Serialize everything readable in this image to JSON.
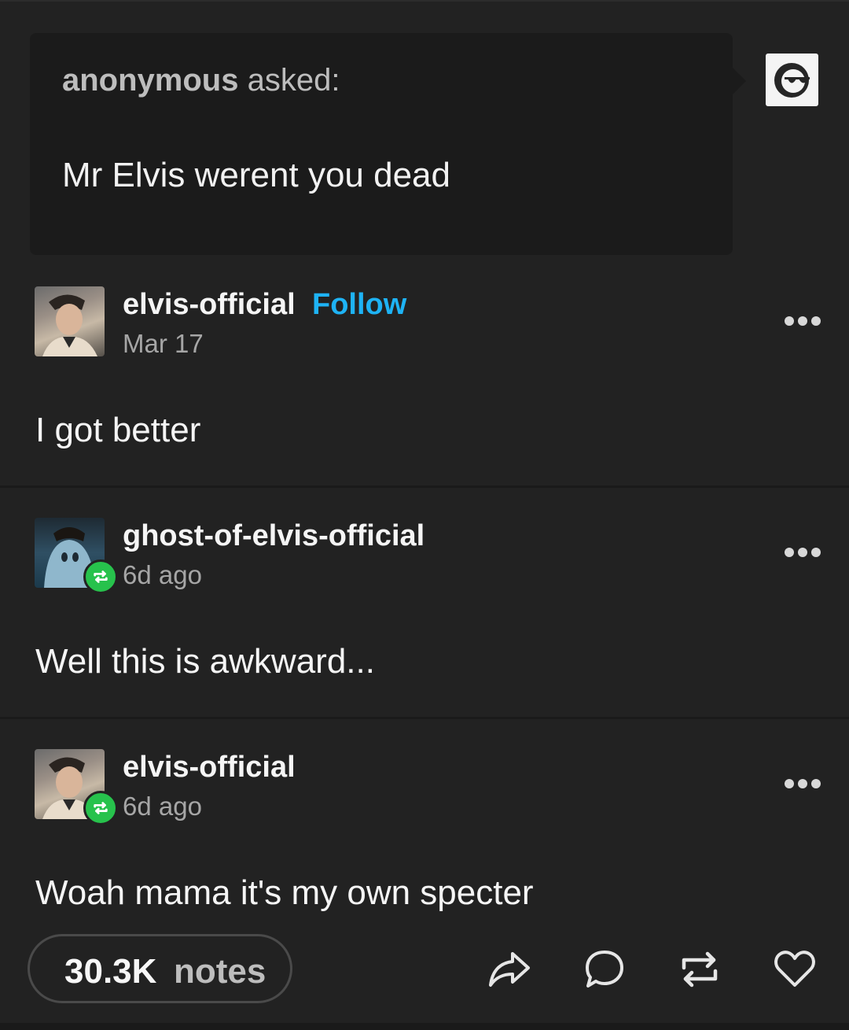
{
  "ask": {
    "asker_name": "anonymous",
    "asker_verb": " asked:",
    "question": "Mr Elvis werent you dead"
  },
  "posts": [
    {
      "username": "elvis-official",
      "follow_label": "Follow",
      "time": "Mar 17",
      "text": "I got better"
    },
    {
      "username": "ghost-of-elvis-official",
      "time": "6d ago",
      "text": "Well this is awkward..."
    },
    {
      "username": "elvis-official",
      "time": "6d ago",
      "text": "Woah mama it's my own specter"
    }
  ],
  "footer": {
    "notes_count": "30.3K",
    "notes_label": "notes",
    "actions": [
      "share-icon",
      "reply-icon",
      "reblog-icon",
      "like-icon"
    ]
  },
  "colors": {
    "background": "#222222",
    "follow": "#1eb3f5",
    "reblog_badge": "#27c24c"
  }
}
